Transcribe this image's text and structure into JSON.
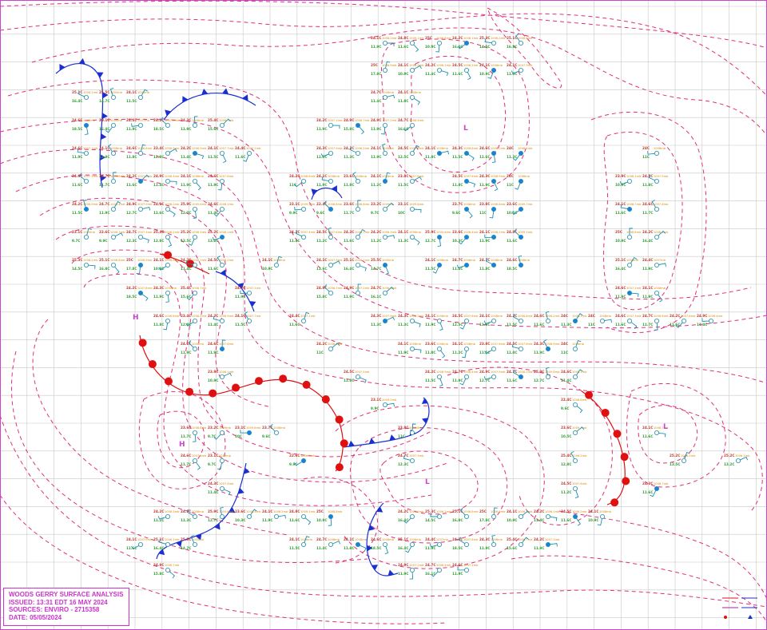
{
  "title_box": {
    "line1": "WOODS GERRY SURFACE ANALYSIS",
    "line2": "ISSUED: 13:31 EDT 16 MAY 2024",
    "line3": "SOURCES: ENVIRO - 2715358",
    "line4": "DATE: 05/05/2024"
  },
  "pressure_labels": [
    {
      "letter": "H",
      "color": "#cc44cc"
    },
    {
      "letter": "H",
      "color": "#cc44cc"
    },
    {
      "letter": "L",
      "color": "#cc44cc"
    },
    {
      "letter": "L",
      "color": "#cc44cc"
    },
    {
      "letter": "L",
      "color": "#cc44cc"
    }
  ],
  "colors": {
    "isobar": "#e0307a",
    "grid": "#c8c8c8",
    "cold_front": "#1a2fd0",
    "warm_front": "#e01010",
    "temperature_text": "#c0392b",
    "pressure_text": "#d98a00",
    "dewpoint_text": "#2e9e2e",
    "station": "#1b8fb0",
    "frame": "#cc33cc"
  },
  "stations": [
    {
      "t": "24.1C",
      "p": "1008.2mb",
      "d": "11.9C",
      "sky": "partial"
    },
    {
      "t": "24.8C",
      "p": "1009.1mb",
      "d": "11.6C",
      "sky": "clear"
    },
    {
      "t": "25C",
      "p": "1008.8mb",
      "d": "10.9C",
      "sky": "clear"
    },
    {
      "t": "24.2C",
      "p": "1008.1mb",
      "d": "16.4C",
      "sky": "clear"
    },
    {
      "t": "25.3C",
      "p": "1006.2mb",
      "d": "14.5C",
      "sky": "partial"
    },
    {
      "t": "25.1C",
      "p": "1006.8mb",
      "d": "16.8C",
      "sky": "clear"
    },
    {
      "t": "25C",
      "p": "1006.9mb",
      "d": "17.8C",
      "sky": "clear"
    },
    {
      "t": "24.1C",
      "p": "1006.3mb",
      "d": "10.9C",
      "sky": "clear"
    },
    {
      "t": "24.2C",
      "p": "1006.1mb",
      "d": "11.4C",
      "sky": "clear"
    },
    {
      "t": "24.5C",
      "p": "1006.2mb",
      "d": "11.6C",
      "sky": "clear"
    },
    {
      "t": "24.1C",
      "p": "1008mb",
      "d": "10.9C",
      "sky": "clear"
    },
    {
      "t": "24.1C",
      "p": "1007.9mb",
      "d": "11.6C",
      "sky": "clear"
    },
    {
      "t": "25.1C",
      "p": "1006.1mb",
      "d": "16.4C",
      "sky": "clear"
    },
    {
      "t": "25.5C",
      "p": "1005mb",
      "d": "14.7C",
      "sky": "clear"
    },
    {
      "t": "24.1C",
      "p": "1006mb",
      "d": "11.5C",
      "sky": "clear"
    },
    {
      "t": "24.7C",
      "p": "1006mb",
      "d": "11.4C",
      "sky": "clear"
    },
    {
      "t": "24.1C",
      "p": "1008mb",
      "d": "11.8C",
      "sky": "clear"
    },
    {
      "t": "24.6C",
      "p": "1008mb",
      "d": "18.5C",
      "sky": "clear"
    },
    {
      "t": "25.1C",
      "p": "1006mb",
      "d": "16.4C",
      "sky": "clear"
    },
    {
      "t": "24.4C",
      "p": "1007mb",
      "d": "11.9C",
      "sky": "clear"
    },
    {
      "t": "24.2C",
      "p": "1007.8mb",
      "d": "18.5C",
      "sky": "clear"
    },
    {
      "t": "24.3C",
      "p": "1008mb",
      "d": "11.9C",
      "sky": "clear"
    },
    {
      "t": "25.4C",
      "p": "1006.7mb",
      "d": "15.6C",
      "sky": "clear"
    },
    {
      "t": "24.2C",
      "p": "1007.1mb",
      "d": "11.9C",
      "sky": "clear"
    },
    {
      "t": "24.9C",
      "p": "1006.7mb",
      "d": "15.8C",
      "sky": "clear"
    },
    {
      "t": "24.9C",
      "p": "1007.2mb",
      "d": "11.9C",
      "sky": "clear"
    },
    {
      "t": "24.7C",
      "p": "1006.4mb",
      "d": "16.1C",
      "sky": "clear"
    },
    {
      "t": "24.6C",
      "p": "1007.1mb",
      "d": "11.9C",
      "sky": "clear"
    },
    {
      "t": "24.1C",
      "p": "1008mb",
      "d": "11.9C",
      "sky": "clear"
    },
    {
      "t": "24.6C",
      "p": "1006.8mb",
      "d": "11.8C",
      "sky": "clear"
    },
    {
      "t": "23.4C",
      "p": "1008.5mb",
      "d": "12.8C",
      "sky": "clear"
    },
    {
      "t": "24.2C",
      "p": "1006.9mb",
      "d": "11.4C",
      "sky": "clear"
    },
    {
      "t": "24.1C",
      "p": "1007.7mb",
      "d": "11.5C",
      "sky": "clear"
    },
    {
      "t": "24.4C",
      "p": "1007.1mb",
      "d": "11.6C",
      "sky": "clear"
    },
    {
      "t": "24.3C",
      "p": "1007.9mb",
      "d": "11.3C",
      "sky": "clear"
    },
    {
      "t": "24.3C",
      "p": "1006.2mb",
      "d": "11.3C",
      "sky": "clear"
    },
    {
      "t": "24.1C",
      "p": "1008mb",
      "d": "11.9C",
      "sky": "clear"
    },
    {
      "t": "24.5C",
      "p": "1007.6mb",
      "d": "12.5C",
      "sky": "clear"
    },
    {
      "t": "24.1C",
      "p": "1008mb",
      "d": "11.8C",
      "sky": "clear"
    },
    {
      "t": "24.3C",
      "p": "1006.8mb",
      "d": "11.5C",
      "sky": "clear"
    },
    {
      "t": "24.6C",
      "p": "1006.2mb",
      "d": "11.6C",
      "sky": "clear"
    },
    {
      "t": "24C",
      "p": "1008.1mb",
      "d": "11.3C",
      "sky": "clear"
    },
    {
      "t": "24C",
      "p": "1008mb",
      "d": "11C",
      "sky": "clear"
    },
    {
      "t": "24.6C",
      "p": "1007.3mb",
      "d": "11.6C",
      "sky": "clear"
    },
    {
      "t": "24.7C",
      "p": "1006.8mb",
      "d": "11.7C",
      "sky": "clear"
    },
    {
      "t": "24.2C",
      "p": "1007.6mb",
      "d": "11.6C",
      "sky": "clear"
    },
    {
      "t": "24.9C",
      "p": "1006.4mb",
      "d": "11.4C",
      "sky": "clear"
    },
    {
      "t": "24.1C",
      "p": "1008mb",
      "d": "11.9C",
      "sky": "clear"
    },
    {
      "t": "24.6C",
      "p": "1007.6mb",
      "d": "11.9C",
      "sky": "clear"
    },
    {
      "t": "24.2C",
      "p": "1008.6mb",
      "d": "11C",
      "sky": "clear"
    },
    {
      "t": "24.1C",
      "p": "1008mb",
      "d": "11.9C",
      "sky": "clear"
    },
    {
      "t": "23.6C",
      "p": "1008mb",
      "d": "11.8C",
      "sky": "clear"
    },
    {
      "t": "24.1C",
      "p": "1008mb",
      "d": "11.2C",
      "sky": "clear"
    },
    {
      "t": "23.8C",
      "p": "1007.6mb",
      "d": "11.5C",
      "sky": "clear"
    },
    {
      "t": "24.5C",
      "p": "1007.6mb",
      "d": "11.8C",
      "sky": "clear"
    },
    {
      "t": "24.3C",
      "p": "1008.9mb",
      "d": "11.9C",
      "sky": "clear"
    },
    {
      "t": "24C",
      "p": "1008mb",
      "d": "11C",
      "sky": "clear"
    },
    {
      "t": "23.9C",
      "p": "1008.1mb",
      "d": "10.9C",
      "sky": "clear"
    },
    {
      "t": "24.5C",
      "p": "1007.5mb",
      "d": "11.8C",
      "sky": "clear"
    },
    {
      "t": "24.2C",
      "p": "1008.9mb",
      "d": "11.5C",
      "sky": "clear"
    },
    {
      "t": "24.7C",
      "p": "1008.4mb",
      "d": "11.9C",
      "sky": "clear"
    },
    {
      "t": "24.9C",
      "p": "1007.9mb",
      "d": "12.7C",
      "sky": "clear"
    },
    {
      "t": "24.1C",
      "p": "1008.2mb",
      "d": "11.6C",
      "sky": "clear"
    },
    {
      "t": "25.9C",
      "p": "1005.6mb",
      "d": "12.7C",
      "sky": "clear"
    },
    {
      "t": "24.6C",
      "p": "1008.1mb",
      "d": "11.4C",
      "sky": "clear"
    },
    {
      "t": "23.1C",
      "p": "1009.2mb",
      "d": "9.9C",
      "sky": "clear"
    },
    {
      "t": "22.4C",
      "p": "1008.8mb",
      "d": "9.6C",
      "sky": "clear"
    },
    {
      "t": "23.6C",
      "p": "1008.8mb",
      "d": "11.7C",
      "sky": "clear"
    },
    {
      "t": "23.2C",
      "p": "1009mb",
      "d": "9.7C",
      "sky": "clear"
    },
    {
      "t": "23.1C",
      "p": "1009.6mb",
      "d": "10C",
      "sky": "clear"
    },
    {
      "t": "23.7C",
      "p": "1008mb",
      "d": "9.6C",
      "sky": "clear"
    },
    {
      "t": "23.8C",
      "p": "1008.8mb",
      "d": "11C",
      "sky": "clear"
    },
    {
      "t": "23.6C",
      "p": "1009.7mb",
      "d": "10.5C",
      "sky": "clear"
    },
    {
      "t": "24.1C",
      "p": "1008.7mb",
      "d": "11.6C",
      "sky": "clear"
    },
    {
      "t": "24.6C",
      "p": "1007.8mb",
      "d": "11.7C",
      "sky": "clear"
    },
    {
      "t": "23.1C",
      "p": "1009mb",
      "d": "9.7C",
      "sky": "clear"
    },
    {
      "t": "22.6C",
      "p": "1008.7mb",
      "d": "9.9C",
      "sky": "clear"
    },
    {
      "t": "24.7C",
      "p": "1007.3mb",
      "d": "12.3C",
      "sky": "clear"
    },
    {
      "t": "25.4C",
      "p": "1006.2mb",
      "d": "12.8C",
      "sky": "clear"
    },
    {
      "t": "25.2C",
      "p": "1006.5mb",
      "d": "13.5C",
      "sky": "clear"
    },
    {
      "t": "25.2C",
      "p": "1006.1mb",
      "d": "13.2C",
      "sky": "clear"
    },
    {
      "t": "24.3C",
      "p": "1007.4mb",
      "d": "11.4C",
      "sky": "clear"
    },
    {
      "t": "24.5C",
      "p": "1007.6mb",
      "d": "11.2C",
      "sky": "clear"
    },
    {
      "t": "24.3C",
      "p": "1008.7mb",
      "d": "11.6C",
      "sky": "clear"
    },
    {
      "t": "24.2C",
      "p": "1008.3mb",
      "d": "11.2C",
      "sky": "clear"
    },
    {
      "t": "24.1C",
      "p": "1008mb",
      "d": "11.3C",
      "sky": "clear"
    },
    {
      "t": "25.9C",
      "p": "1005.6mb",
      "d": "12.7C",
      "sky": "clear"
    },
    {
      "t": "23.6C",
      "p": "1008.4mb",
      "d": "10.3C",
      "sky": "clear"
    }
  ]
}
